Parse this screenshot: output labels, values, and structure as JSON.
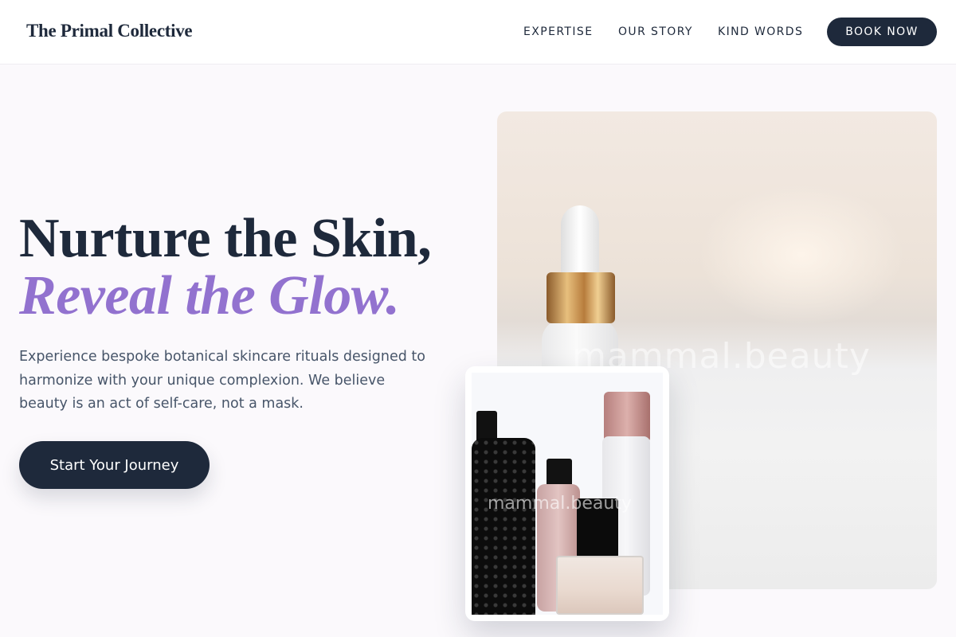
{
  "brand": "The Primal Collective",
  "nav": {
    "links": [
      "EXPERTISE",
      "OUR STORY",
      "KIND WORDS"
    ],
    "book_label": "BOOK NOW"
  },
  "hero": {
    "title_line1": "Nurture the Skin,",
    "title_line2": "Reveal the Glow.",
    "description": "Experience bespoke botanical skincare rituals designed to harmonize with your unique complexion. We believe beauty is an act of self-care, not a mask.",
    "cta_label": "Start Your Journey"
  },
  "images": {
    "main_watermark": "mammal.beauty",
    "card_watermark": "mammal.beauty"
  },
  "colors": {
    "accent": "#9272cf",
    "primary": "#1e293b",
    "background": "#fbf9fc"
  }
}
